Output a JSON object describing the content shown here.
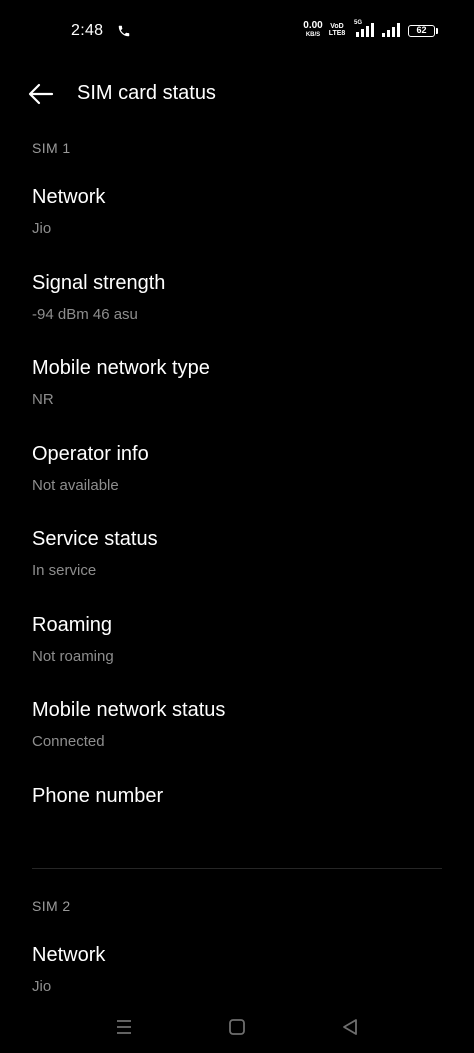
{
  "status_bar": {
    "time": "2:48",
    "net_speed_value": "0.00",
    "net_speed_unit": "KB/S",
    "volte_line1": "VoD",
    "volte_line2": "LTE8",
    "network_tag": "5G",
    "battery": "62"
  },
  "header": {
    "title": "SIM card status"
  },
  "sim1": {
    "header": "SIM 1",
    "items": [
      {
        "title": "Network",
        "value": "Jio"
      },
      {
        "title": "Signal strength",
        "value": "-94 dBm 46 asu"
      },
      {
        "title": "Mobile network type",
        "value": "NR"
      },
      {
        "title": "Operator info",
        "value": "Not available"
      },
      {
        "title": "Service status",
        "value": "In service"
      },
      {
        "title": "Roaming",
        "value": "Not roaming"
      },
      {
        "title": "Mobile network status",
        "value": "Connected"
      },
      {
        "title": "Phone number",
        "value": ""
      }
    ]
  },
  "sim2": {
    "header": "SIM 2",
    "items": [
      {
        "title": "Network",
        "value": "Jio"
      }
    ]
  },
  "icons": {
    "back": "arrow-left-icon",
    "call": "phone-icon",
    "recents": "menu-lines-icon",
    "home": "square-icon",
    "back_nav": "triangle-left-icon"
  },
  "colors": {
    "background": "#000000",
    "primary_text": "#ffffff",
    "secondary_text": "#8e8e8e",
    "section_header": "#9a9a9a"
  }
}
